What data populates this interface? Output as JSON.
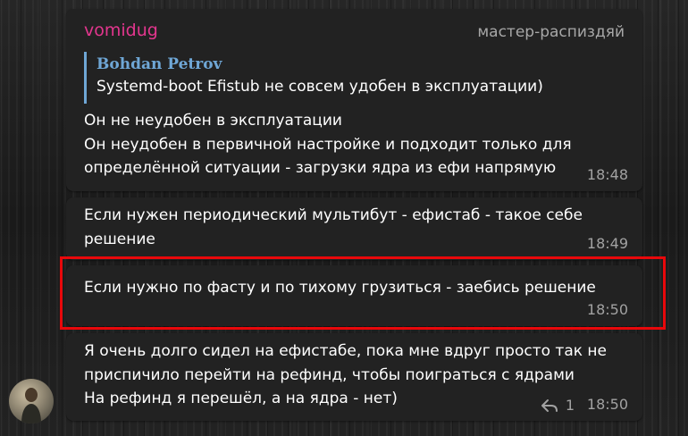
{
  "messages": [
    {
      "sender": "vomidug",
      "role": "мастер-распиздяй",
      "reply_to": {
        "author": "Bohdan Petrov",
        "text": "Systemd-boot  Efistub не совсем удобен в эксплуатации)"
      },
      "lines": [
        "Он не неудобен в эксплуатации",
        "Он неудобен в первичной настройке и подходит только для",
        "определённой ситуации - загрузки ядра из ефи напрямую"
      ],
      "time": "18:48"
    },
    {
      "lines": [
        "Если нужен периодический мультибут - ефистаб - такое себе",
        "решение"
      ],
      "time": "18:49"
    },
    {
      "lines": [
        "Если нужно по фасту и по тихому грузиться - заебись решение"
      ],
      "time": "18:50",
      "highlighted": true
    },
    {
      "lines": [
        "Я очень долго сидел на ефистабе, пока мне вдруг просто так не",
        "приспичило перейти на рефинд, чтобы поиграться с ядрами",
        "На рефинд я перешёл, а на ядра - нет)"
      ],
      "reply_count": "1",
      "time": "18:50"
    }
  ],
  "colors": {
    "sender": "#e3368e",
    "quote_accent": "#6fa7d6",
    "bubble": "#222222",
    "highlight": "#e8080b",
    "meta": "#a2a2a2"
  },
  "icons": {
    "reply": "reply-arrow-icon"
  }
}
